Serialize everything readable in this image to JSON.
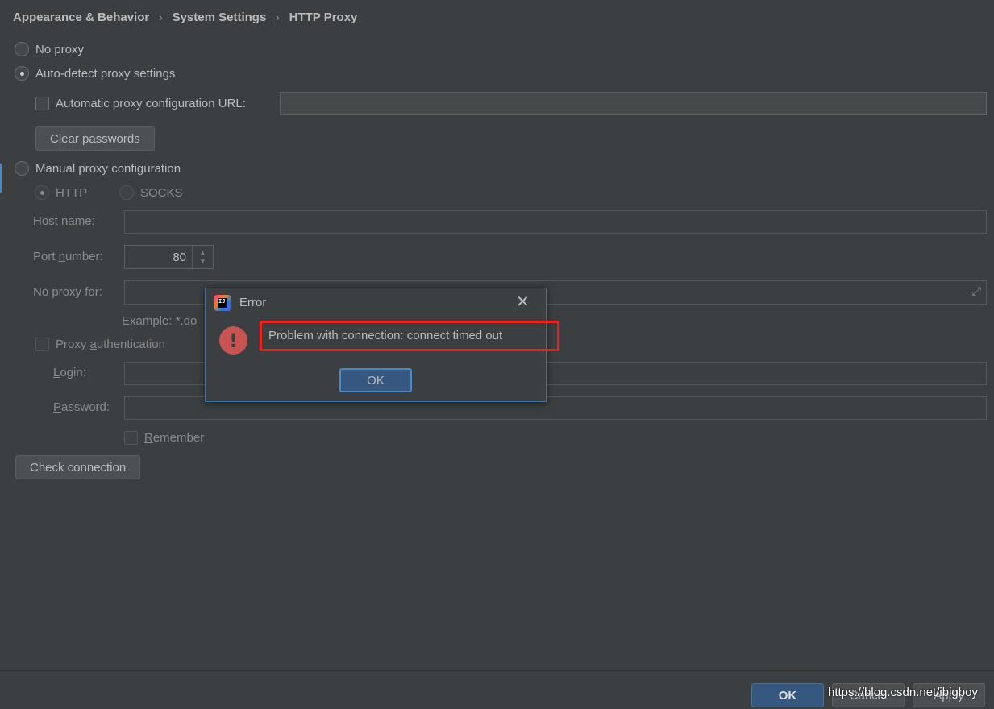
{
  "breadcrumb": [
    "Appearance & Behavior",
    "System Settings",
    "HTTP Proxy"
  ],
  "proxy_mode": {
    "no_proxy_label": "No proxy",
    "auto_detect_label": "Auto-detect proxy settings",
    "manual_label": "Manual proxy configuration",
    "selected": "auto-detect"
  },
  "auto_config": {
    "pac_url_label": "Automatic proxy configuration URL:",
    "pac_url_value": "",
    "clear_passwords_label": "Clear passwords"
  },
  "manual": {
    "http_label": "HTTP",
    "socks_label": "SOCKS",
    "host_name_prefix": "H",
    "host_name_rest": "ost name:",
    "host_name_value": "",
    "port_prefix": "Port ",
    "port_underlined": "n",
    "port_rest": "umber:",
    "port_value": "80",
    "no_proxy_for_label": "No proxy for:",
    "no_proxy_for_value": "",
    "example_text": "Example: *.do"
  },
  "auth": {
    "proxy_auth_prefix": "Proxy ",
    "proxy_auth_underlined": "a",
    "proxy_auth_rest": "uthentication",
    "login_underlined": "L",
    "login_rest": "ogin:",
    "password_underlined": "P",
    "password_rest": "assword:",
    "remember_underlined": "R",
    "remember_rest": "emember"
  },
  "check_connection_label": "Check connection",
  "footer": {
    "ok_label": "OK",
    "cancel_label": "Cancel",
    "apply_label": "Apply"
  },
  "error_dialog": {
    "title": "Error",
    "message": "Problem with connection: connect timed out",
    "ok_label": "OK",
    "icon_glyph": "!",
    "app_icon_text": "IJ"
  },
  "watermark": "https://blog.csdn.net/ibigboy",
  "colors": {
    "background": "#3c3f41",
    "text": "#bbbbbb",
    "primary_button": "#365880",
    "error_red": "#c75450",
    "highlight_red": "#e8221c"
  }
}
